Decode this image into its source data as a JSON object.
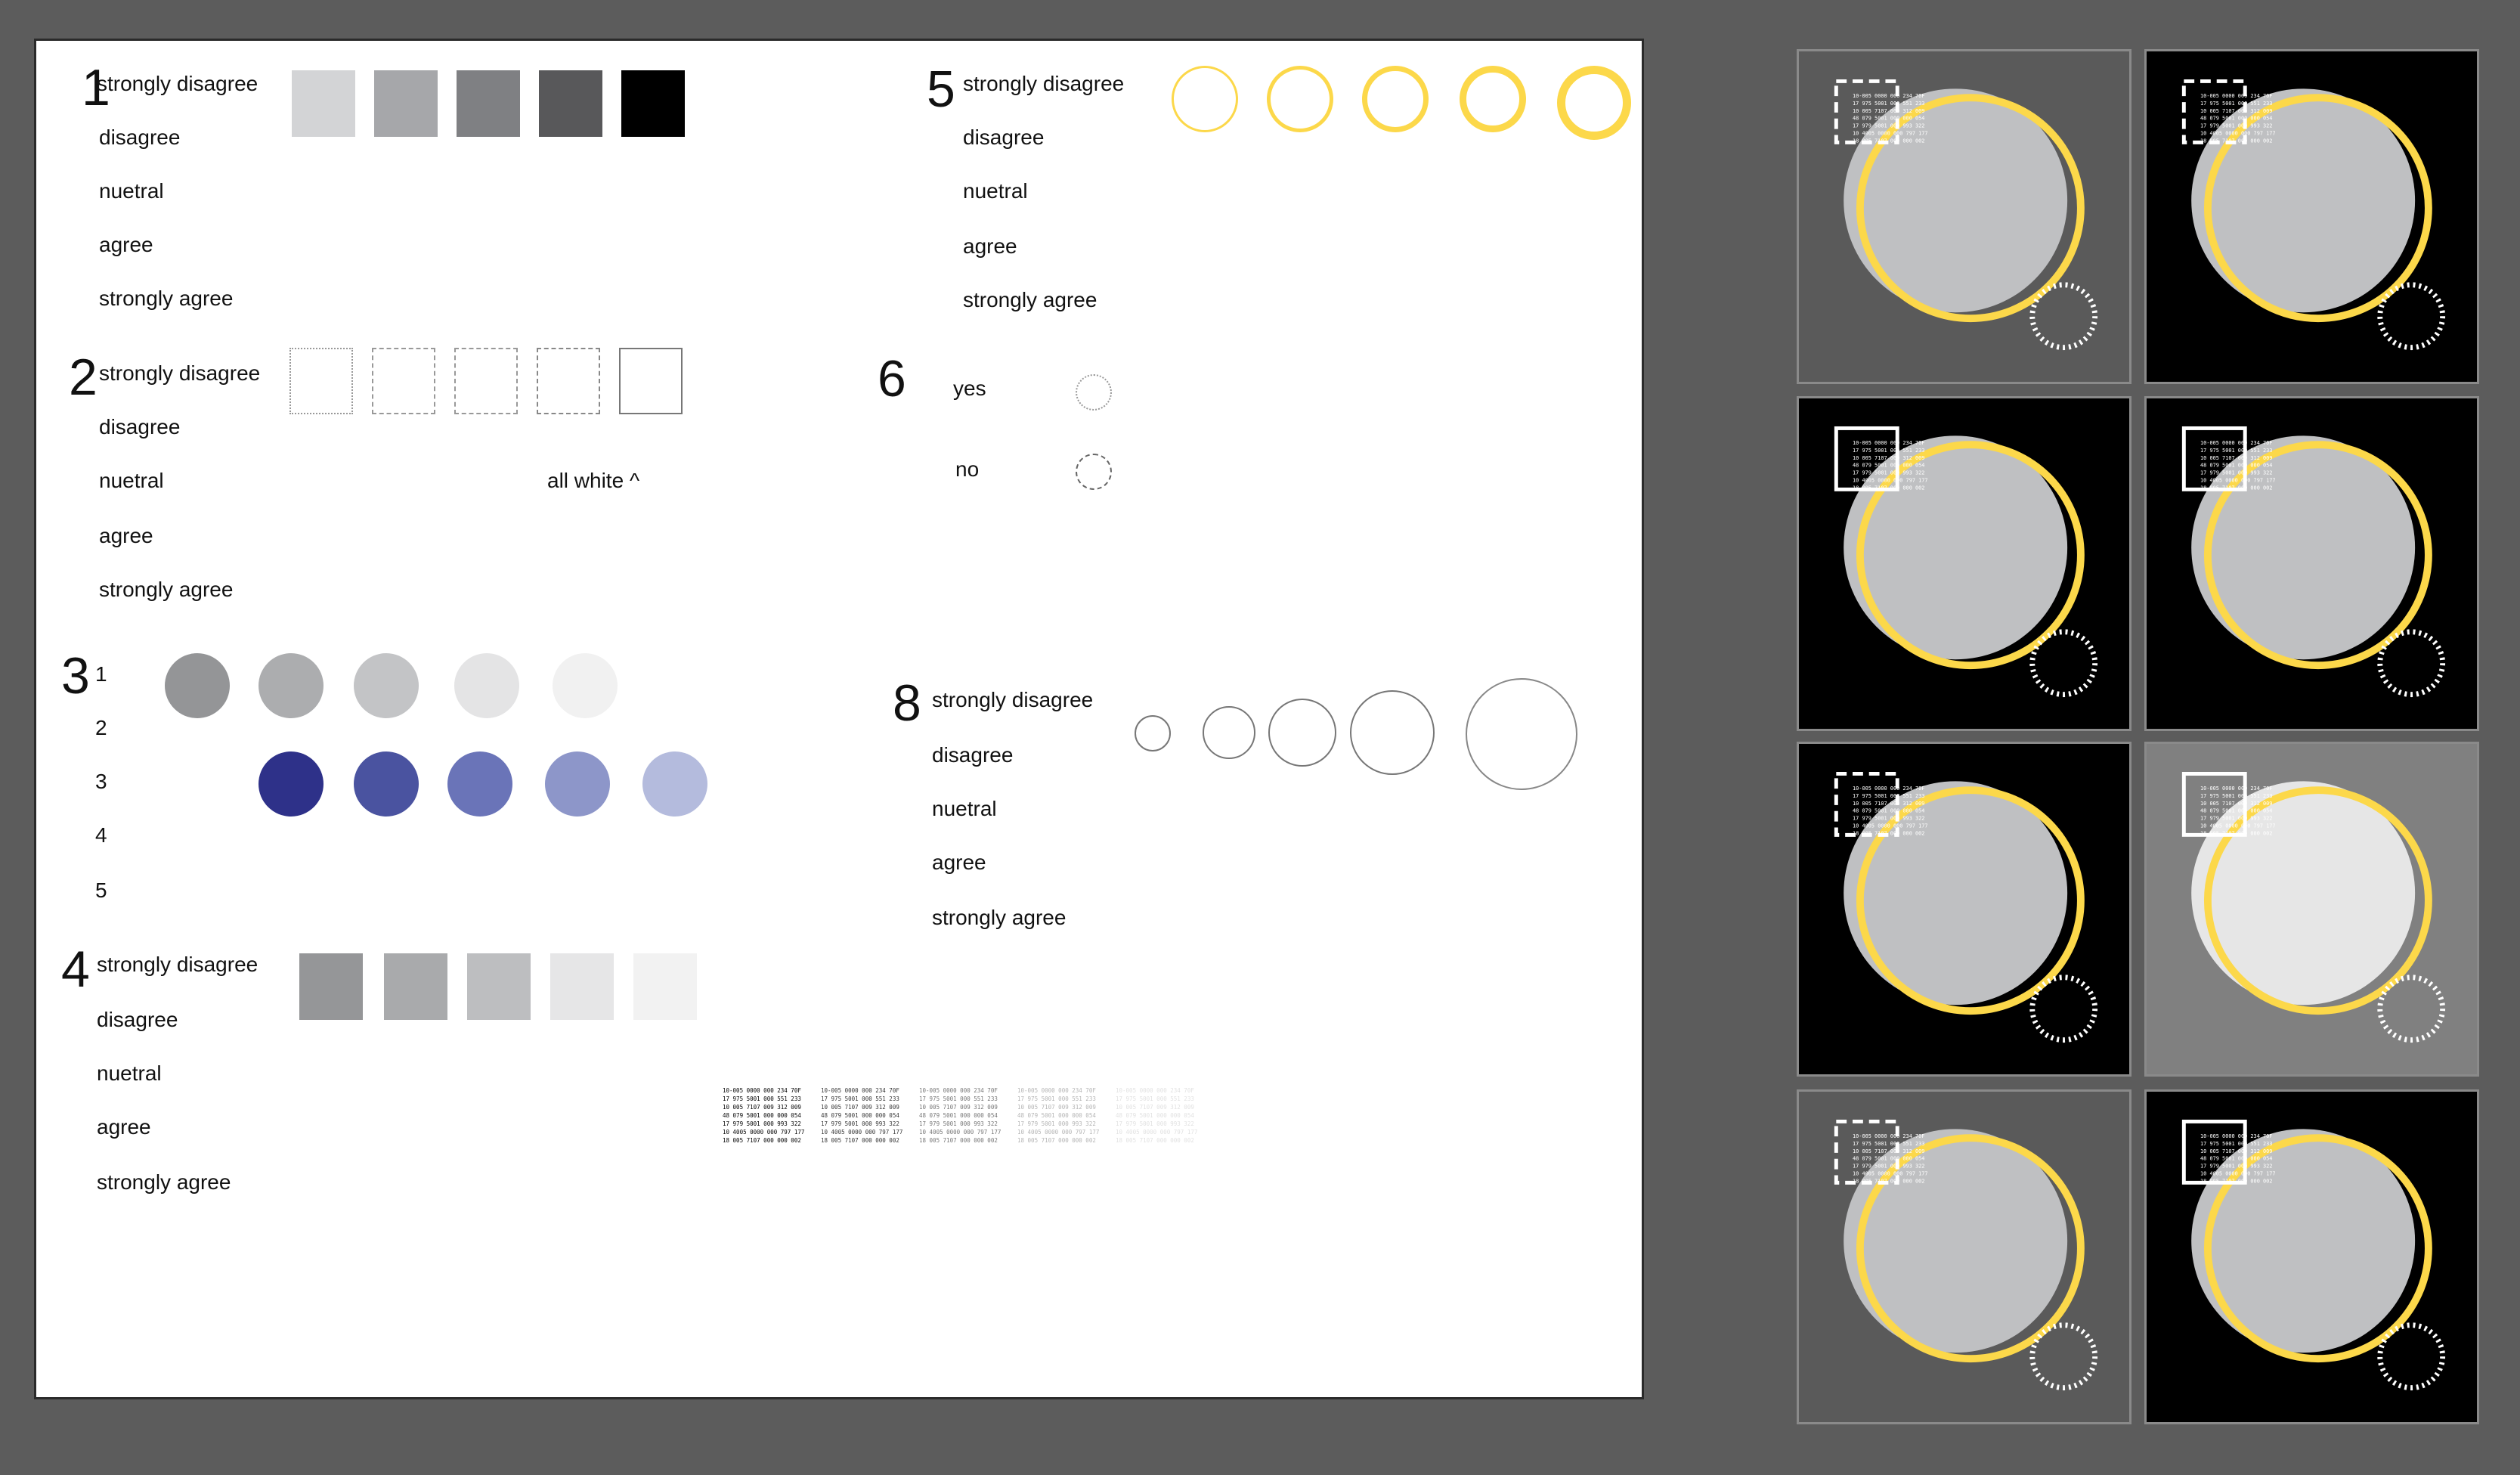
{
  "colors": {
    "app_background": "#5c5c5c",
    "artboard": "#ffffff",
    "yellow": "#fcd84a",
    "light_gray": "#bfc0c2",
    "black": "#000000",
    "dark_tile": "#5a5a5a",
    "mid_tile": "#808080"
  },
  "section1": {
    "number": "1",
    "labels": [
      "strongly disagree",
      "disagree",
      "nuetral",
      "agree",
      "strongly agree"
    ],
    "swatch_colors": [
      "#d3d4d6",
      "#a6a7aa",
      "#7f8083",
      "#58585a",
      "#000000"
    ]
  },
  "section2": {
    "number": "2",
    "labels": [
      "strongly disagree",
      "disagree",
      "nuetral",
      "agree",
      "strongly agree"
    ],
    "note": "all white ^",
    "swatch_borders": [
      "dotted",
      "dashed",
      "dashed",
      "dashed",
      "solid"
    ]
  },
  "section3": {
    "number": "3",
    "labels": [
      "1",
      "2",
      "3",
      "4",
      "5"
    ],
    "gray_colors": [
      "#949597",
      "#acadaf",
      "#c3c4c6",
      "#e4e4e5",
      "#f1f1f1"
    ],
    "blue_colors": [
      "#2e3189",
      "#4a53a0",
      "#6a74b8",
      "#8d96c9",
      "#b4bbdd"
    ]
  },
  "section4": {
    "number": "4",
    "labels": [
      "strongly disagree",
      "disagree",
      "nuetral",
      "agree",
      "strongly agree"
    ],
    "swatch_colors": [
      "#959698",
      "#a9aaac",
      "#bdbec0",
      "#e6e6e7",
      "#f2f2f2"
    ]
  },
  "section5": {
    "number": "5",
    "labels": [
      "strongly disagree",
      "disagree",
      "nuetral",
      "agree",
      "strongly agree"
    ],
    "ring_stroke_levels": [
      1,
      2,
      3,
      4,
      5
    ]
  },
  "section6": {
    "number": "6",
    "labels": [
      "yes",
      "no"
    ]
  },
  "section8": {
    "number": "8",
    "labels": [
      "strongly disagree",
      "disagree",
      "nuetral",
      "agree",
      "strongly agree"
    ],
    "ring_size_levels": [
      1,
      2,
      3,
      4,
      5
    ]
  },
  "numeric_text": {
    "lines": [
      "10-005 0000 000 234 70F",
      "17 975 5001 000 551 233",
      "10 005 7107 009 312 009",
      "48 079 5001 000 000 054",
      "17 979 5001 000 993 322",
      "10 4005 0000 000 797 177",
      "18 005 7107 000 000 002"
    ],
    "opacity_levels": [
      1,
      0.8,
      0.55,
      0.3,
      0.12
    ]
  },
  "thumbnails": [
    {
      "bg": "#5a5a5a",
      "frame": "dashed"
    },
    {
      "bg": "#000000",
      "frame": "dashed"
    },
    {
      "bg": "#000000",
      "frame": "solid"
    },
    {
      "bg": "#000000",
      "frame": "solid"
    },
    {
      "bg": "#000000",
      "frame": "dashed"
    },
    {
      "bg": "#808080",
      "frame": "solid"
    },
    {
      "bg": "#5a5a5a",
      "frame": "dashed"
    },
    {
      "bg": "#000000",
      "frame": "solid"
    }
  ]
}
